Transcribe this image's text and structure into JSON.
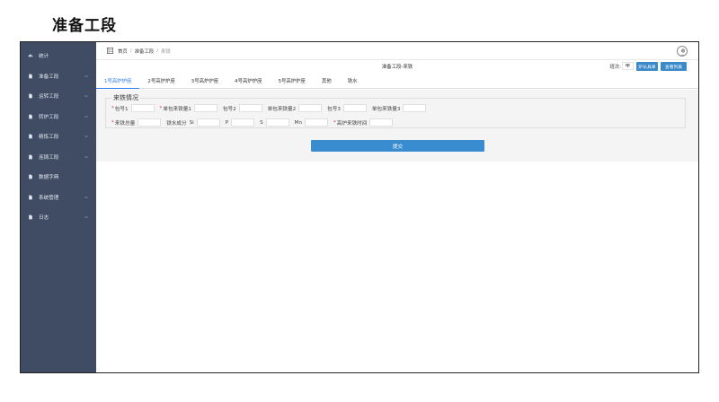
{
  "page_heading": "准备工段",
  "sidebar": {
    "items": [
      {
        "label": "统计",
        "icon": "dashboard-icon",
        "has_arrow": false
      },
      {
        "label": "准备工段",
        "icon": "document-icon",
        "has_arrow": true
      },
      {
        "label": "运转工段",
        "icon": "document-icon",
        "has_arrow": true
      },
      {
        "label": "转炉工段",
        "icon": "document-icon",
        "has_arrow": true
      },
      {
        "label": "精炼工段",
        "icon": "document-icon",
        "has_arrow": true
      },
      {
        "label": "连铸工段",
        "icon": "document-icon",
        "has_arrow": true
      },
      {
        "label": "数据字典",
        "icon": "document-icon",
        "has_arrow": false
      },
      {
        "label": "系统管理",
        "icon": "document-icon",
        "has_arrow": true
      },
      {
        "label": "日志",
        "icon": "document-icon",
        "has_arrow": true
      }
    ]
  },
  "breadcrumb": {
    "home": "首页",
    "section": "准备工段",
    "current": "来铁"
  },
  "subheader": {
    "title": "准备工段-来铁",
    "shift_label": "班次:",
    "shift_value": "甲",
    "furnace_button": "炉长具单",
    "list_button": "查看列表"
  },
  "tabs": [
    "1号高炉炉座",
    "2号高炉炉座",
    "3号高炉炉座",
    "4号高炉炉座",
    "5号高炉炉座",
    "其他",
    "铁水"
  ],
  "form": {
    "legend": "来铁情况",
    "row1": [
      {
        "label": "包号1",
        "required": true
      },
      {
        "label": "单包来铁量1",
        "required": true
      },
      {
        "label": "包号2",
        "required": false
      },
      {
        "label": "单包来铁量2",
        "required": false
      },
      {
        "label": "包号3",
        "required": false
      },
      {
        "label": "单包来铁量3",
        "required": false
      }
    ],
    "row2": {
      "total_label": "来铁总量",
      "composition_label": "铁水成分",
      "si_label": "Si",
      "p_label": "P",
      "s_label": "S",
      "mn_label": "Mn",
      "time_label": "高炉来铁时间"
    },
    "submit": "提交"
  },
  "colors": {
    "sidebar_bg": "#3f4c63",
    "accent": "#3a89c9",
    "active_tab": "#2f80ed"
  }
}
